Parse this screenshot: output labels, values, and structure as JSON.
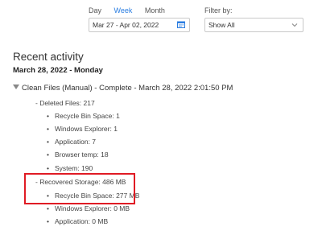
{
  "view_tabs": {
    "day": "Day",
    "week": "Week",
    "month": "Month",
    "active": "week"
  },
  "date_range": {
    "value": "Mar 27 - Apr 02, 2022"
  },
  "filter": {
    "label": "Filter by:",
    "value": "Show All"
  },
  "section_title": "Recent activity",
  "date_heading": "March 28, 2022 - Monday",
  "session": {
    "label": "Clean Files (Manual) - Complete - March 28, 2022 2:01:50 PM",
    "deleted_files": {
      "label": "- Deleted Files: 217",
      "items": [
        "Recycle Bin Space: 1",
        "Windows Explorer: 1",
        "Application: 7",
        "Browser temp: 18",
        "System: 190"
      ]
    },
    "recovered_storage": {
      "label": "- Recovered Storage: 486 MB",
      "items": [
        "Recycle Bin Space: 277 MB",
        "Windows Explorer: 0 MB",
        "Application: 0 MB"
      ]
    }
  },
  "colors": {
    "accent": "#2a7de1",
    "highlight_border": "#e01b24"
  }
}
